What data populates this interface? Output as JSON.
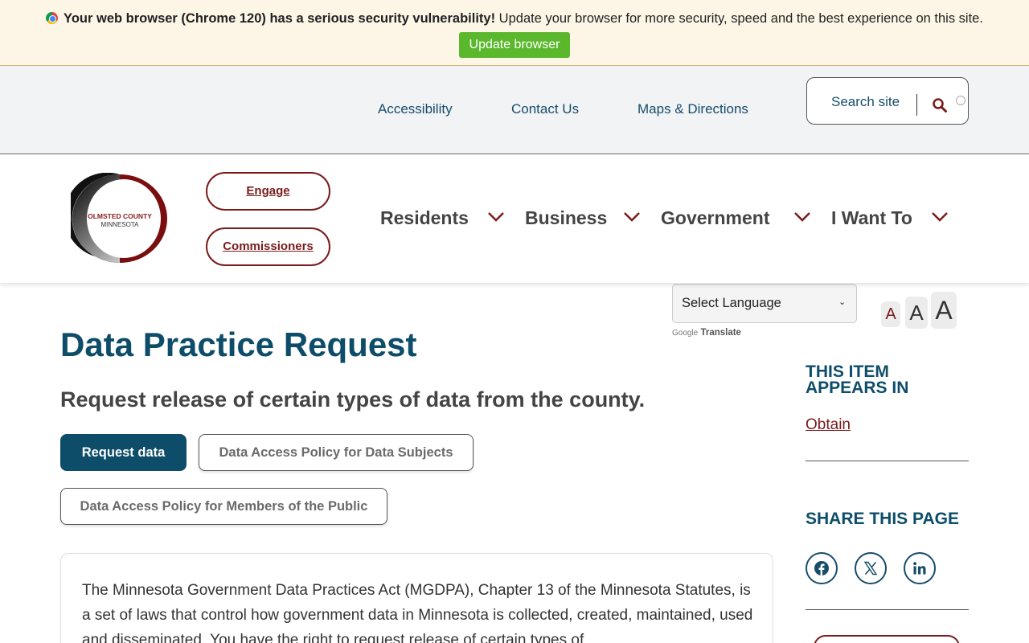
{
  "banner": {
    "bold_text": "Your web browser (Chrome 120) has a serious security vulnerability!",
    "rest_text": " Update your browser for more security, speed and the best experience on this site.",
    "button_label": "Update browser"
  },
  "utility_nav": {
    "links": [
      "Accessibility",
      "Contact Us",
      "Maps & Directions"
    ],
    "search_label": "Search site"
  },
  "logo": {
    "line1": "OLMSTED COUNTY",
    "line2": "MINNESOTA"
  },
  "quick_links": [
    "Engage",
    "Commissioners"
  ],
  "main_nav": [
    "Residents",
    "Business",
    "Government",
    "I Want To"
  ],
  "language": {
    "select_label": "Select Language",
    "google": "Google",
    "translate": "Translate"
  },
  "font_size": {
    "small": "A",
    "medium": "A",
    "large": "A"
  },
  "page": {
    "title": "Data Practice Request",
    "subtitle": "Request release of certain types of data from the county.",
    "primary_button": "Request data",
    "button_subjects": "Data Access Policy for Data Subjects",
    "button_public": "Data Access Policy for Members of the Public",
    "body": "The Minnesota Government Data Practices Act (MGDPA), Chapter 13 of the Minnesota Statutes, is a set of laws that control how government data in Minnesota is collected, created, maintained, used and disseminated. You have the right to request release of certain types of"
  },
  "sidebar": {
    "appears_in_heading_line1": "THIS ITEM",
    "appears_in_heading_line2": "APPEARS IN",
    "appears_in_link": "Obtain",
    "share_heading": "SHARE THIS PAGE",
    "share_icons": [
      "facebook-icon",
      "x-icon",
      "linkedin-icon"
    ]
  },
  "colors": {
    "brand_blue": "#0d4d69",
    "brand_red": "#7a1b1b",
    "update_green": "#5bb82c",
    "banner_bg": "#fdf5e6"
  }
}
